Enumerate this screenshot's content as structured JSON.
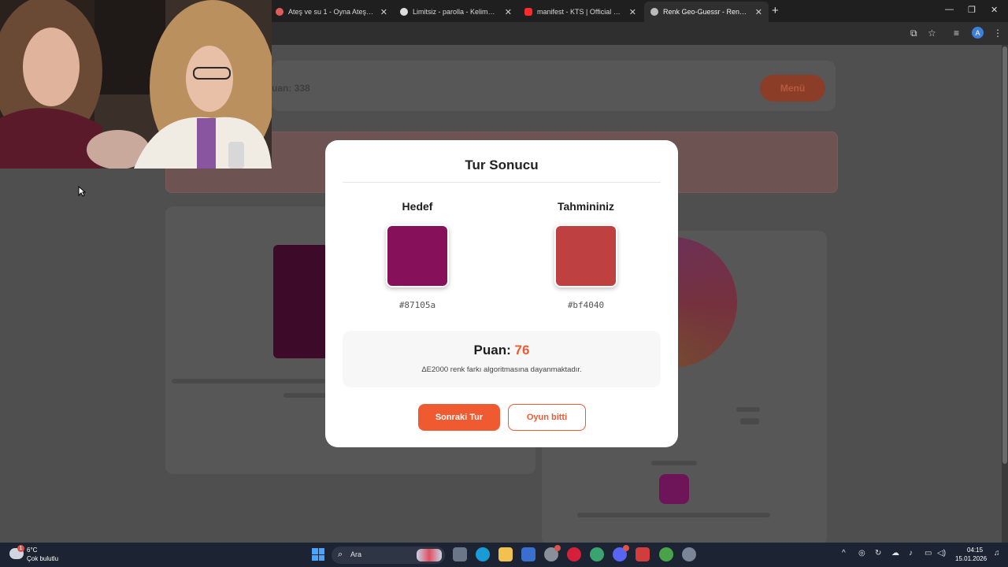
{
  "browser": {
    "tabs": [
      {
        "title": "Ateş ve su 1 - Oyna Ateş ve su",
        "favicon_color": "#e05b5b"
      },
      {
        "title": "Limitsiz - parolla - Kelime oyunu",
        "favicon_color": "#dddddd"
      },
      {
        "title": "manifest - KTS | Official Music V",
        "favicon_color": "#ff2a2a"
      },
      {
        "title": "Renk Geo-Guessr - Renk Algıları",
        "favicon_color": "#bbbbbb"
      }
    ],
    "profile_initial": "A"
  },
  "page_bg": {
    "top_text": "uan: 338",
    "menu_button": "Menü"
  },
  "modal": {
    "title": "Tur Sonucu",
    "target_label": "Hedef",
    "target_color": "#87105a",
    "target_hex": "#87105a",
    "guess_label": "Tahmininiz",
    "guess_color": "#bf4040",
    "guess_hex": "#bf4040",
    "score_label": "Puan:",
    "score_value": "76",
    "score_note": "ΔE2000 renk farkı algoritmasına dayanmaktadır.",
    "next_button": "Sonraki Tur",
    "end_button": "Oyun bitti"
  },
  "accent_color": "#ef5a30",
  "taskbar": {
    "temperature": "6°C",
    "weather": "Çok bulutlu",
    "weather_badge": "1",
    "search_label": "Ara",
    "time": "04:15",
    "date": "15.01.2026"
  }
}
